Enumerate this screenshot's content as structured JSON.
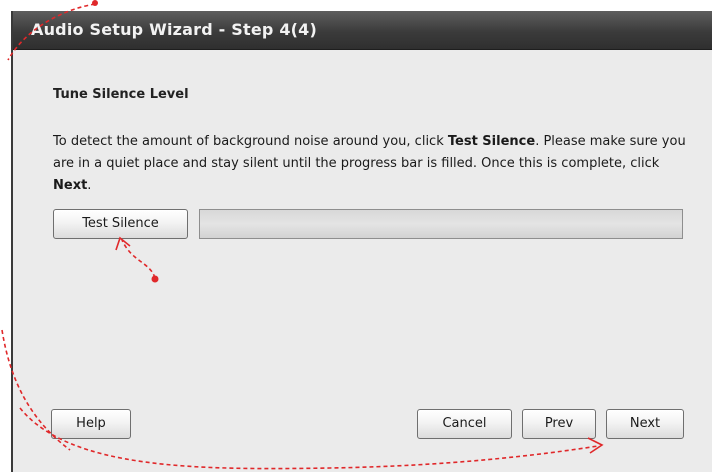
{
  "window": {
    "title": "Audio Setup Wizard - Step 4(4)"
  },
  "content": {
    "section_title": "Tune Silence Level",
    "instructions": {
      "line1_pre": "To detect the amount of background noise around you, click ",
      "line1_bold": "Test Silence",
      "line1_post": ". Please make sure you are in a quiet place and stay silent until the progress bar is filled. Once this is complete, click ",
      "line2_bold": "Next",
      "line2_post": "."
    },
    "test_button_label": "Test Silence",
    "progress": {
      "fraction": 0
    }
  },
  "footer": {
    "help_label": "Help",
    "cancel_label": "Cancel",
    "prev_label": "Prev",
    "next_label": "Next"
  },
  "annotation": {
    "color": "#e0282a"
  }
}
